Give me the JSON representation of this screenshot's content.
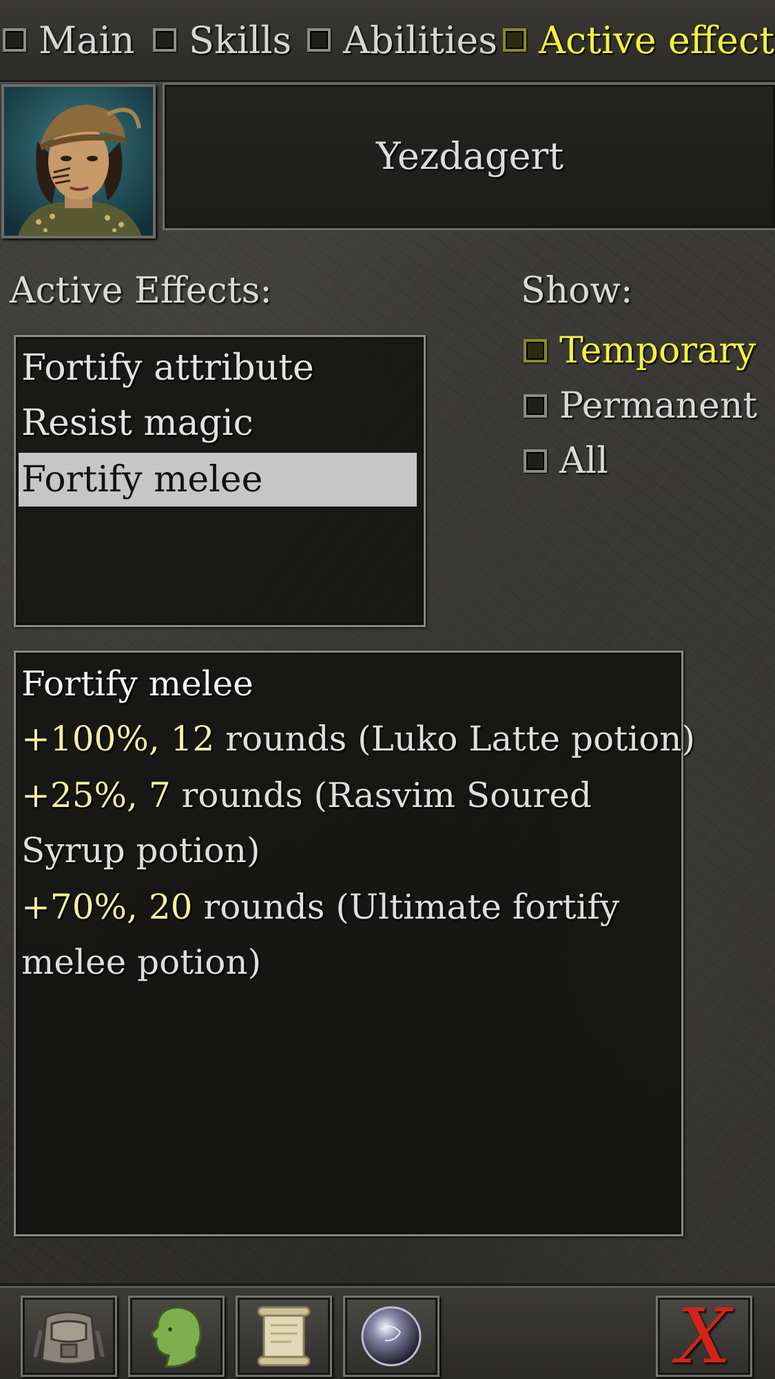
{
  "tabs": [
    {
      "label": "Main",
      "active": false
    },
    {
      "label": "Skills",
      "active": false
    },
    {
      "label": "Abilities",
      "active": false
    },
    {
      "label": "Active effects",
      "active": true
    }
  ],
  "character": {
    "name": "Yezdagert",
    "portrait_icon": "character-portrait"
  },
  "effects_panel": {
    "heading": "Active Effects:",
    "items": [
      "Fortify attribute",
      "Resist magic",
      "Fortify melee"
    ],
    "selected_index": 2
  },
  "show_panel": {
    "heading": "Show:",
    "options": [
      {
        "label": "Temporary",
        "checked": true
      },
      {
        "label": "Permanent",
        "checked": false
      },
      {
        "label": "All",
        "checked": false
      }
    ]
  },
  "details": {
    "title": "Fortify melee",
    "entries": [
      {
        "percent": "+100%,",
        "rounds": "12",
        "rest": " rounds (Luko Latte potion)"
      },
      {
        "percent": "+25%,",
        "rounds": "7",
        "rest": " rounds (Rasvim Soured",
        "cont": "Syrup potion)"
      },
      {
        "percent": "+70%,",
        "rounds": "20",
        "rest": " rounds (Ultimate fortify",
        "cont": "melee potion)"
      }
    ]
  },
  "toolbar": {
    "buttons": [
      "backpack-icon",
      "head-icon",
      "scroll-icon",
      "orb-icon"
    ],
    "close_label": "X"
  },
  "colors": {
    "active_tab": "#f2f23c",
    "number_highlight": "#f3f0a0",
    "close": "#d42418"
  }
}
